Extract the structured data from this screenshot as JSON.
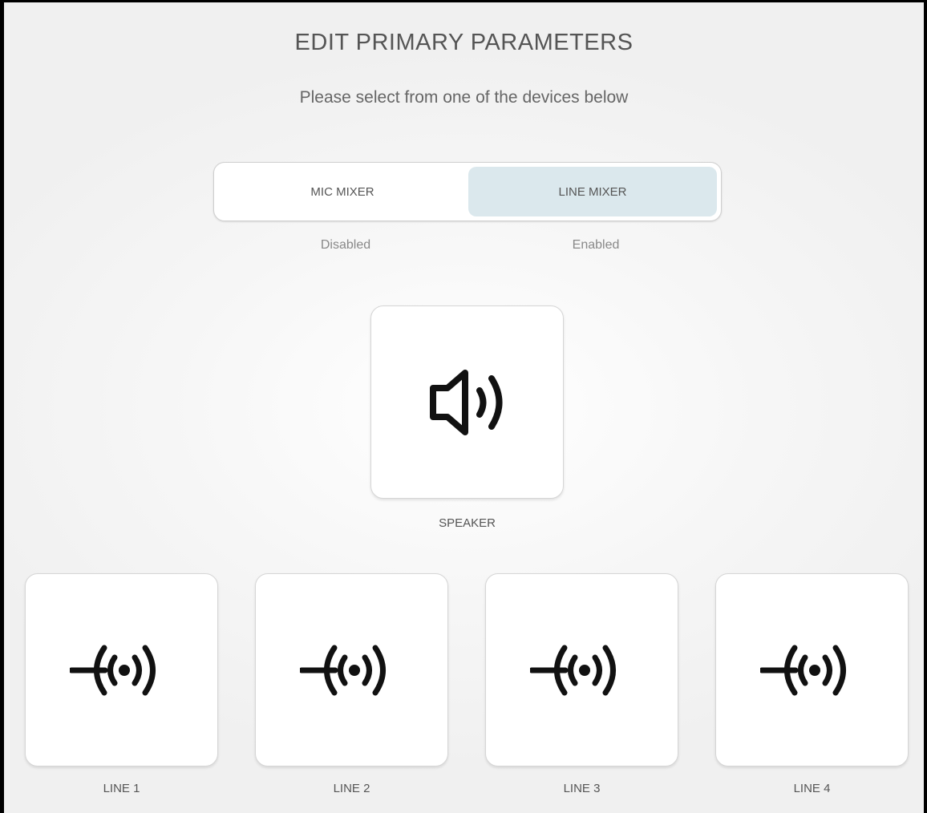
{
  "header": {
    "title": "EDIT PRIMARY PARAMETERS",
    "subtitle": "Please select from one of the devices below"
  },
  "mixer_toggle": {
    "options": [
      {
        "label": "MIC MIXER",
        "status": "Disabled",
        "selected": false
      },
      {
        "label": "LINE MIXER",
        "status": "Enabled",
        "selected": true
      }
    ],
    "selected_color": "#dbe8ed"
  },
  "devices": {
    "speaker": {
      "label": "SPEAKER",
      "icon": "speaker-icon"
    },
    "lines": [
      {
        "label": "LINE 1",
        "icon": "line-input-icon"
      },
      {
        "label": "LINE 2",
        "icon": "line-input-icon"
      },
      {
        "label": "LINE 3",
        "icon": "line-input-icon"
      },
      {
        "label": "LINE 4",
        "icon": "line-input-icon"
      }
    ]
  }
}
